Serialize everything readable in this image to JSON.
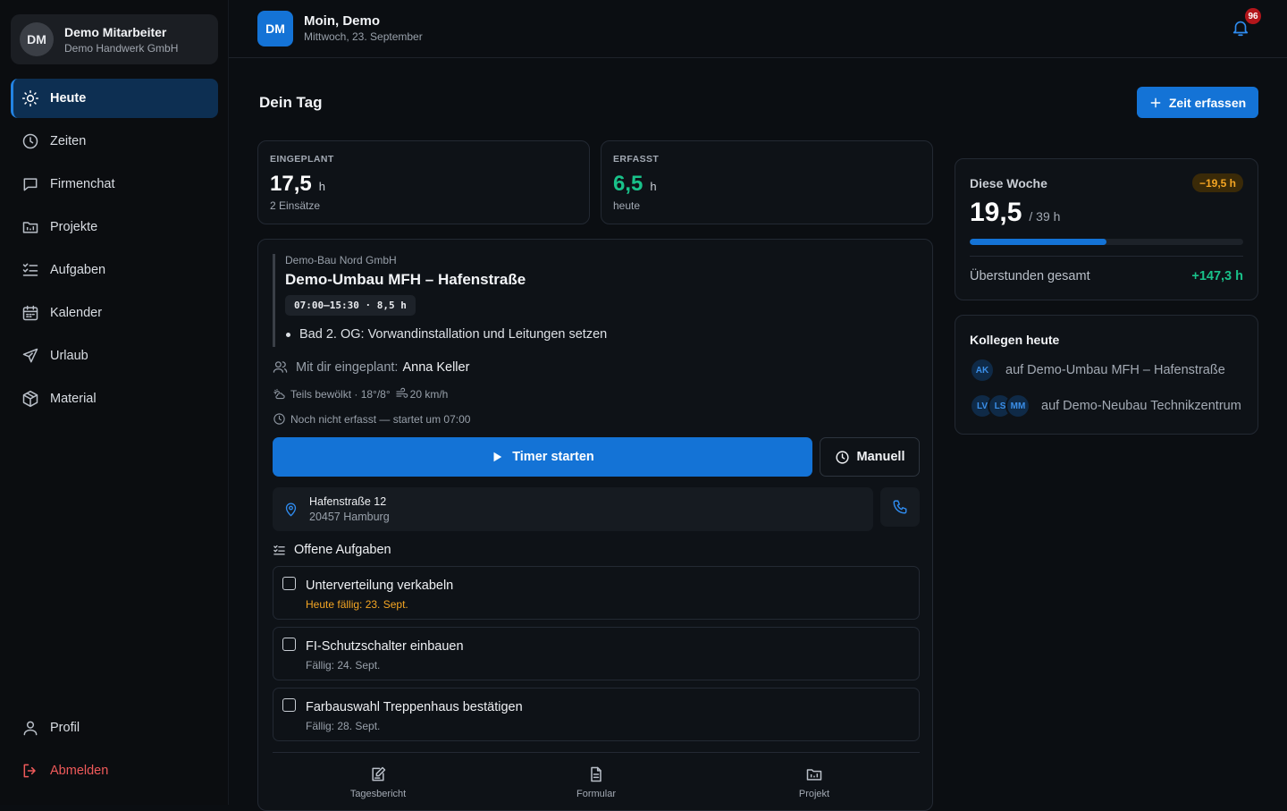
{
  "user": {
    "initials": "DM",
    "name": "Demo Mitarbeiter",
    "company": "Demo Handwerk GmbH"
  },
  "nav": {
    "items": [
      {
        "label": "Heute",
        "icon": "sun-icon",
        "active": true
      },
      {
        "label": "Zeiten",
        "icon": "clock-icon"
      },
      {
        "label": "Firmenchat",
        "icon": "chat-icon"
      },
      {
        "label": "Projekte",
        "icon": "folder-icon"
      },
      {
        "label": "Aufgaben",
        "icon": "list-checks-icon"
      },
      {
        "label": "Kalender",
        "icon": "calendar-icon"
      },
      {
        "label": "Urlaub",
        "icon": "plane-icon"
      },
      {
        "label": "Material",
        "icon": "package-icon"
      }
    ],
    "profile": "Profil",
    "logout": "Abmelden"
  },
  "header": {
    "initials": "DM",
    "greeting": "Moin, Demo",
    "date": "Mittwoch, 23. September",
    "notifications": "96"
  },
  "page": {
    "title": "Dein Tag",
    "add_time": "Zeit erfassen"
  },
  "stats": {
    "planned": {
      "label": "EINGEPLANT",
      "value": "17,5",
      "unit": "h",
      "sub": "2 Einsätze"
    },
    "logged": {
      "label": "ERFASST",
      "value": "6,5",
      "unit": "h",
      "sub": "heute"
    }
  },
  "job": {
    "client": "Demo-Bau Nord GmbH",
    "title": "Demo-Umbau MFH – Hafenstraße",
    "time": "07:00–15:30 · 8,5 h",
    "task_note": "Bad 2. OG: Vorwandinstallation und Leitungen setzen",
    "coworker_label": "Mit dir eingeplant:",
    "coworker_name": "Anna Keller",
    "weather": "Teils bewölkt · 18°/8°",
    "wind": "20 km/h",
    "status": "Noch nicht erfasst — startet um 07:00",
    "timer_button": "Timer starten",
    "manual_button": "Manuell",
    "address_street": "Hafenstraße 12",
    "address_city": "20457 Hamburg",
    "tasks_title": "Offene Aufgaben",
    "tasks": [
      {
        "name": "Unterverteilung verkabeln",
        "due": "Heute fällig: 23. Sept."
      },
      {
        "name": "FI-Schutzschalter einbauen",
        "due": "Fällig: 24. Sept."
      },
      {
        "name": "Farbauswahl Treppenhaus bestätigen",
        "due": "Fällig: 28. Sept."
      }
    ],
    "footer": {
      "report": "Tagesbericht",
      "form": "Formular",
      "project": "Projekt"
    }
  },
  "week": {
    "title": "Diese Woche",
    "delta": "−19,5 h",
    "value": "19,5",
    "target": "/ 39 h",
    "progress": 0.5,
    "overtime_label": "Überstunden gesamt",
    "overtime_value": "+147,3 h"
  },
  "colleagues": {
    "title": "Kollegen heute",
    "rows": [
      {
        "avatars": [
          "AK"
        ],
        "text": "auf Demo-Umbau MFH – Hafenstraße"
      },
      {
        "avatars": [
          "LV",
          "LS",
          "MM"
        ],
        "text": "auf Demo-Neubau Technikzentrum"
      }
    ]
  },
  "colors": {
    "accent": "#1473d6",
    "success": "#19c28a",
    "warning": "#f5a623",
    "danger": "#ef5a5a"
  }
}
